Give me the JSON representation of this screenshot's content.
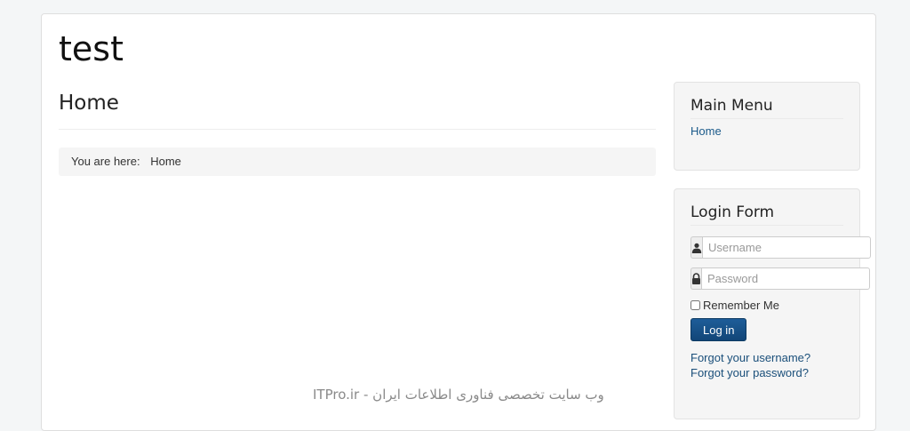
{
  "site": {
    "title": "test"
  },
  "main": {
    "heading": "Home",
    "breadcrumb": {
      "prefix": "You are here:",
      "current": "Home"
    }
  },
  "sidebar": {
    "main_menu": {
      "title": "Main Menu",
      "items": [
        {
          "label": "Home"
        }
      ]
    },
    "login_form": {
      "title": "Login Form",
      "username_placeholder": "Username",
      "password_placeholder": "Password",
      "remember_label": "Remember Me",
      "login_label": "Log in",
      "forgot_username": "Forgot your username?",
      "forgot_password": "Forgot your password?"
    }
  },
  "watermark": {
    "text": "ITPro.ir - وب سایت تخصصی فناوری اطلاعات ایران"
  },
  "icons": {
    "username": "user-icon",
    "password": "lock-icon"
  },
  "colors": {
    "link": "#1a5a8a",
    "button": "#124678",
    "background": "#f4f6f7"
  }
}
